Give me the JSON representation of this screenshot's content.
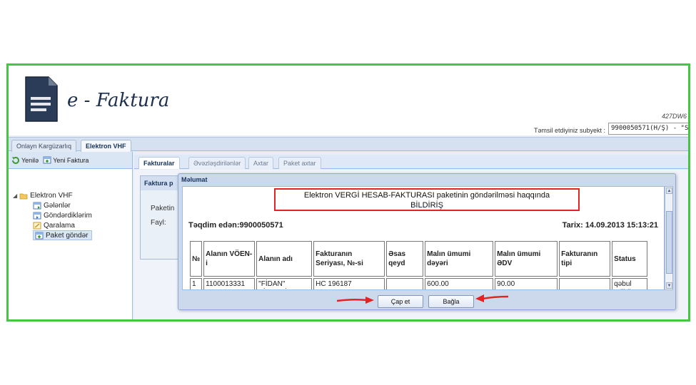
{
  "app": {
    "title": "e - Faktura",
    "version_text": "427DW6",
    "subject_label": "Təmsil etdiyiniz subyekt :",
    "subject_value": "9900050571(H/Ş) - \"S"
  },
  "top_tabs": [
    "Onlayn Kargüzarlıq",
    "Elektron VHF"
  ],
  "left_panel": {
    "toolbar": {
      "refresh": "Yenilə",
      "new_invoice": "Yeni Faktura"
    },
    "tree": {
      "root": "Elektron VHF",
      "items": [
        "Gələnlər",
        "Göndərdiklərim",
        "Qaralama",
        "Paket göndər"
      ]
    }
  },
  "main_tabs": [
    "Fakturalar",
    "Əvəzləşdirilənlər",
    "Axtar",
    "Paket axtar"
  ],
  "inner_panel": {
    "title": "Faktura p",
    "paket_label": "Paketin",
    "file_label": "Fayl:"
  },
  "modal": {
    "title": "Məlumat",
    "notice_line1": "Elektron VERGİ HESAB-FAKTURASI paketinin göndərilməsi haqqında",
    "notice_line2": "BİLDİRİŞ",
    "submitted_by": "Təqdim edən:9900050571",
    "date": "Tarix: 14.09.2013 15:13:21",
    "columns": [
      "№",
      "Alanın VÖEN-i",
      "Alanın adı",
      "Fakturanın Seriyası, №-si",
      "Əsas qeyd",
      "Malın ümumi dəyəri",
      "Malın ümumi ƏDV",
      "Fakturanın tipi",
      "Status"
    ],
    "rows": [
      [
        "1",
        "1100013331",
        "\"FİDAN\" ŞİRKƏTİ",
        "HC 196187",
        "",
        "600.00",
        "90.00",
        "",
        "qəbul edildi"
      ]
    ],
    "print_button": "Çap et",
    "close_button": "Bağla"
  },
  "colors": {
    "frame_border": "#46c544",
    "notice_border": "#e32222",
    "arrow": "#e32222"
  }
}
